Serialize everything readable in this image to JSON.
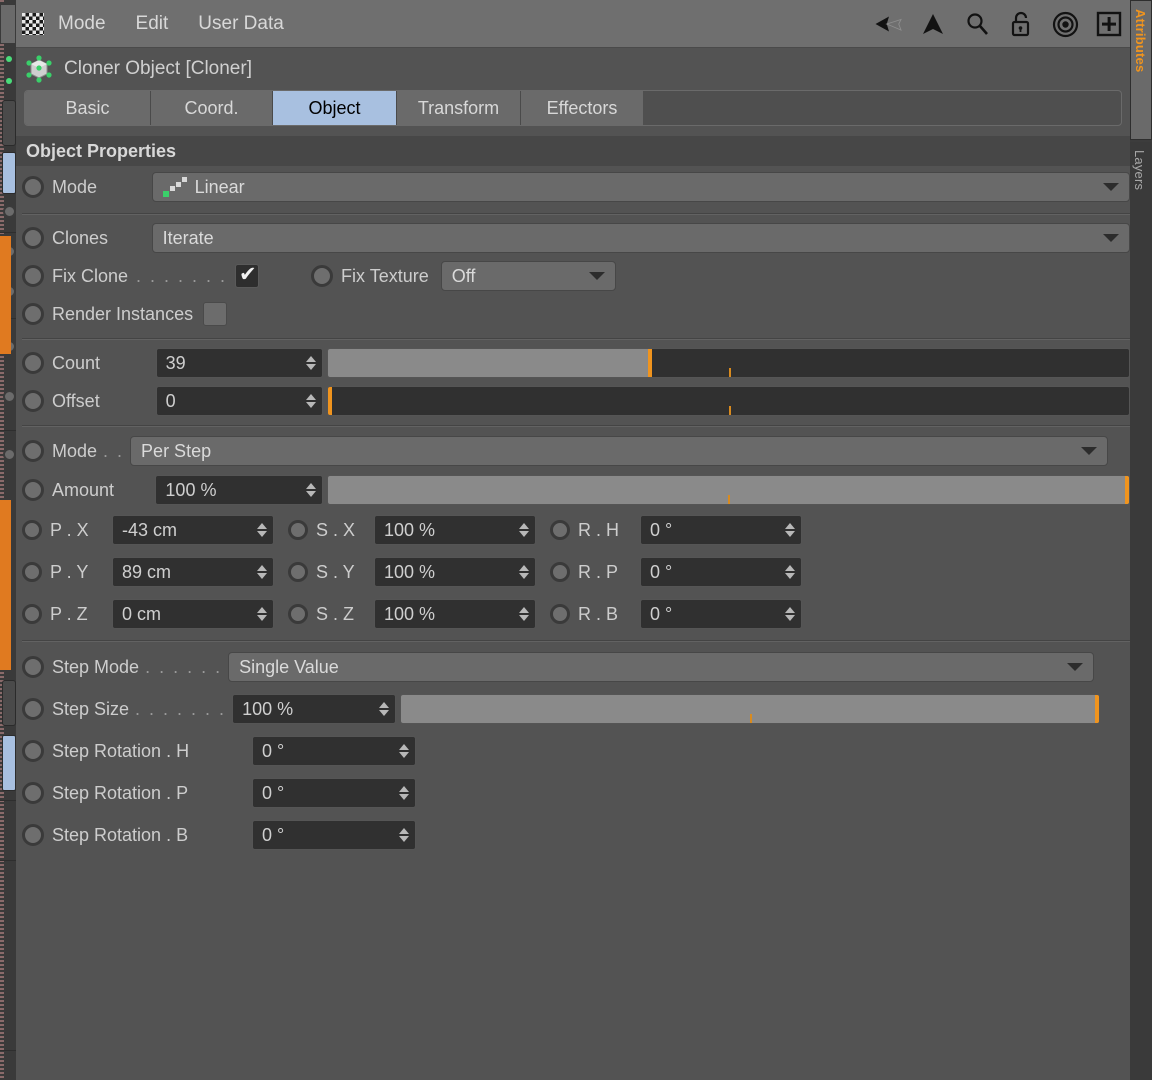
{
  "menubar": {
    "app_icon": "checker-icon",
    "items": [
      "Mode",
      "Edit",
      "User Data"
    ],
    "icons": [
      "back-arrow-icon",
      "up-arrow-icon",
      "search-icon",
      "lock-icon",
      "target-icon",
      "plus-icon"
    ]
  },
  "object_header": {
    "icon": "cloner-object-icon",
    "title": "Cloner Object [Cloner]"
  },
  "tabs": [
    {
      "label": "Basic",
      "selected": false
    },
    {
      "label": "Coord.",
      "selected": false
    },
    {
      "label": "Object",
      "selected": true
    },
    {
      "label": "Transform",
      "selected": false
    },
    {
      "label": "Effectors",
      "selected": false
    }
  ],
  "section": {
    "title": "Object Properties"
  },
  "fields": {
    "mode": {
      "label": "Mode",
      "value": "Linear",
      "icon": "linear-mode-icon"
    },
    "clones": {
      "label": "Clones",
      "value": "Iterate"
    },
    "fix_clone": {
      "label": "Fix Clone",
      "dots": ". . . . . . .",
      "checked": true
    },
    "fix_texture": {
      "label": "Fix Texture",
      "value": "Off"
    },
    "render_instances": {
      "label": "Render Instances",
      "checked": false
    },
    "count": {
      "label": "Count",
      "value": "39",
      "fill_pct": 44
    },
    "offset": {
      "label": "Offset",
      "value": "0",
      "fill_pct": 0
    },
    "transform_mode": {
      "label": "Mode",
      "dots": ". .",
      "value": "Per Step"
    },
    "amount": {
      "label": "Amount",
      "value": "100 %",
      "fill_pct": 100
    },
    "p_x": {
      "label": "P . X",
      "value": "-43 cm"
    },
    "p_y": {
      "label": "P . Y",
      "value": "89 cm"
    },
    "p_z": {
      "label": "P . Z",
      "value": "0 cm"
    },
    "s_x": {
      "label": "S . X",
      "value": "100 %"
    },
    "s_y": {
      "label": "S . Y",
      "value": "100 %"
    },
    "s_z": {
      "label": "S . Z",
      "value": "100 %"
    },
    "r_h": {
      "label": "R . H",
      "value": "0 °"
    },
    "r_p": {
      "label": "R . P",
      "value": "0 °"
    },
    "r_b": {
      "label": "R . B",
      "value": "0 °"
    },
    "step_mode": {
      "label": "Step Mode",
      "dots": ". . . . . .",
      "value": "Single Value"
    },
    "step_size": {
      "label": "Step Size",
      "dots": ". . . . . . .",
      "value": "100 %",
      "fill_pct": 100
    },
    "step_rot_h": {
      "label": "Step Rotation . H",
      "value": "0 °"
    },
    "step_rot_p": {
      "label": "Step Rotation . P",
      "value": "0 °"
    },
    "step_rot_b": {
      "label": "Step Rotation . B",
      "value": "0 °"
    }
  },
  "right_rail": {
    "top_tab_label": "Attributes",
    "lower_tab_label": "Layers"
  },
  "colors": {
    "panel_bg": "#535353",
    "menubar_bg": "#6f6f6f",
    "tab_selected": "#a8c0e0",
    "accent_orange": "#f0941e",
    "field_bg": "#303030",
    "combo_bg": "#6a6a6a"
  }
}
